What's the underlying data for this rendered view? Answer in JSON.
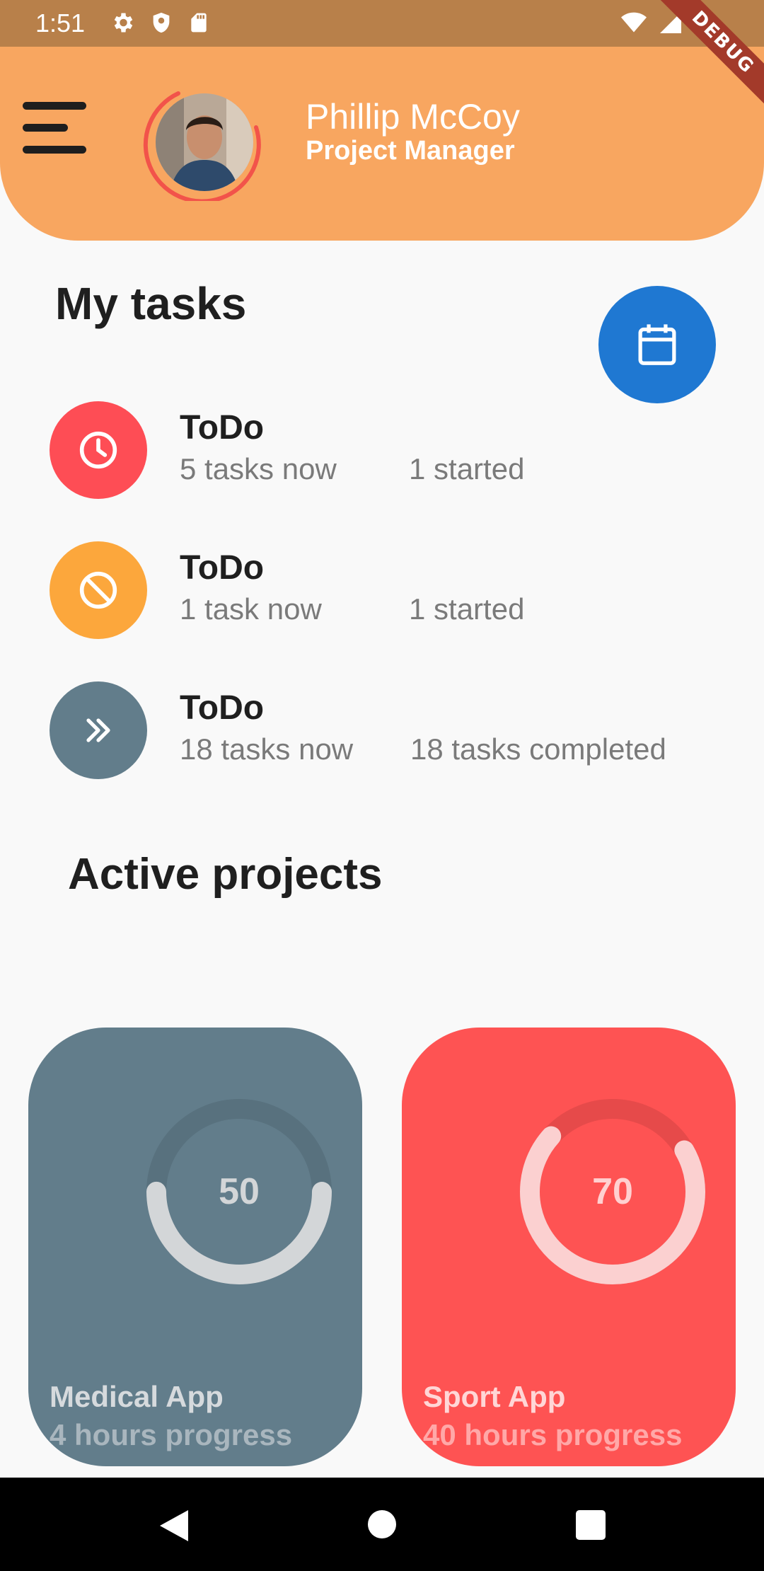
{
  "status_bar": {
    "time": "1:51",
    "icons": [
      "settings-icon",
      "shield-icon",
      "sd-card-icon",
      "wifi-icon",
      "signal-icon",
      "battery-icon"
    ]
  },
  "debug_banner": "DEBUG",
  "header": {
    "name": "Phillip McCoy",
    "role": "Project Manager",
    "background_color": "#f8a660",
    "avatar_ring_color": "#f2534a"
  },
  "my_tasks": {
    "title": "My tasks",
    "calendar_button_color": "#1f78d2",
    "items": [
      {
        "title": "ToDo",
        "count": "5 tasks now",
        "status": "1 started",
        "icon": "clock-icon",
        "color": "#fe4d55"
      },
      {
        "title": "ToDo",
        "count": "1 task now",
        "status": "1 started",
        "icon": "block-icon",
        "color": "#fca73c"
      },
      {
        "title": "ToDo",
        "count": "18 tasks now",
        "status": "18 tasks completed",
        "icon": "double-chevron-right-icon",
        "color": "#627d8b"
      }
    ]
  },
  "active_projects": {
    "title": "Active projects",
    "cards": [
      {
        "name": "Medical App",
        "subtitle": "4 hours progress",
        "progress": 50,
        "progress_label": "50",
        "color": "#627d8b"
      },
      {
        "name": "Sport App",
        "subtitle": "40 hours progress",
        "progress": 70,
        "progress_label": "70",
        "color": "#fe5353"
      }
    ]
  },
  "nav_bar": {
    "icons": [
      "back-icon",
      "home-icon",
      "recents-icon"
    ]
  }
}
